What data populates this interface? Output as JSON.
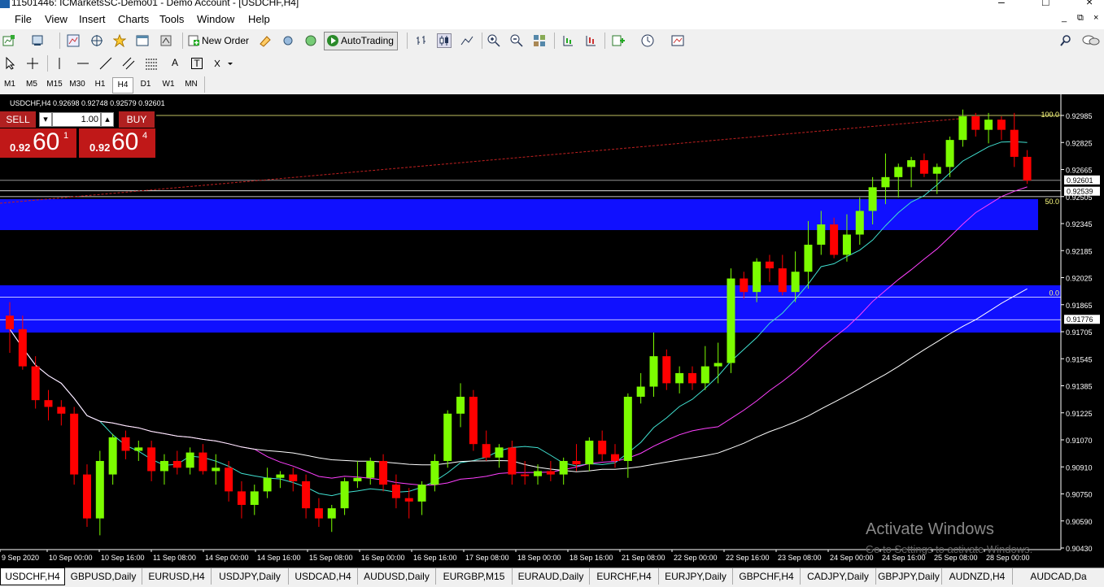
{
  "window": {
    "title": "11501446: ICMarketsSC-Demo01 - Demo Account - [USDCHF,H4]",
    "minimize": "–",
    "maximize": "□",
    "close": "×"
  },
  "menu": {
    "items": [
      "File",
      "View",
      "Insert",
      "Charts",
      "Tools",
      "Window",
      "Help"
    ],
    "mdi_controls": [
      "_",
      "⧉",
      "×"
    ]
  },
  "toolbar1": {
    "new_order": "New Order",
    "autotrading": "AutoTrading"
  },
  "toolbar2": {
    "text_tool": "A",
    "label_tool": "T"
  },
  "timeframes": {
    "items": [
      "M1",
      "M5",
      "M15",
      "M30",
      "H1",
      "H4",
      "D1",
      "W1",
      "MN"
    ],
    "active": "H4"
  },
  "chart": {
    "header": "USDCHF,H4  0.92698 0.92748 0.92579 0.92601",
    "one_click": {
      "sell_label": "SELL",
      "buy_label": "BUY",
      "lot": "1.00",
      "sell_small": "0.92",
      "sell_big": "60",
      "sell_sup": "1",
      "buy_small": "0.92",
      "buy_big": "60",
      "buy_sup": "4"
    },
    "price_labels": [
      "0.92985",
      "0.92825",
      "0.92665",
      "0.92505",
      "0.92345",
      "0.92185",
      "0.92025",
      "0.91865",
      "0.91705",
      "0.91545",
      "0.91385",
      "0.91225",
      "0.91070",
      "0.90910",
      "0.90750",
      "0.90590",
      "0.90430"
    ],
    "marker_bid": "0.92601",
    "marker_ask": "0.92539",
    "marker_line": "0.91776",
    "fib_100": "100.0",
    "fib_50": "50.0",
    "fib_0": "0.0",
    "time_labels": [
      "9 Sep 2020",
      "10 Sep 00:00",
      "10 Sep 16:00",
      "11 Sep 08:00",
      "14 Sep 00:00",
      "14 Sep 16:00",
      "15 Sep 08:00",
      "16 Sep 00:00",
      "16 Sep 16:00",
      "17 Sep 08:00",
      "18 Sep 00:00",
      "18 Sep 16:00",
      "21 Sep 08:00",
      "22 Sep 00:00",
      "22 Sep 16:00",
      "23 Sep 08:00",
      "24 Sep 00:00",
      "24 Sep 16:00",
      "25 Sep 08:00",
      "28 Sep 00:00"
    ],
    "watermark_title": "Activate Windows",
    "watermark_sub": "Go to Settings to activate Windows.",
    "colors": {
      "bull": "#7cfc00",
      "bear": "#ff0000",
      "zone": "#1010ff",
      "ma_fast": "#40e0d0",
      "ma_mid": "#ff40ff",
      "ma_slow": "#ffffff",
      "trend": "#c02020",
      "fib": "#ffff80"
    }
  },
  "tabs": {
    "items": [
      "USDCHF,H4",
      "GBPUSD,Daily",
      "EURUSD,H4",
      "USDJPY,Daily",
      "USDCAD,H4",
      "AUDUSD,Daily",
      "EURGBP,M15",
      "EURAUD,Daily",
      "EURCHF,H4",
      "EURJPY,Daily",
      "GBPCHF,H4",
      "CADJPY,Daily",
      "GBPJPY,Daily",
      "AUDNZD,H4",
      "AUDCAD,Da"
    ],
    "active": "USDCHF,H4"
  }
}
